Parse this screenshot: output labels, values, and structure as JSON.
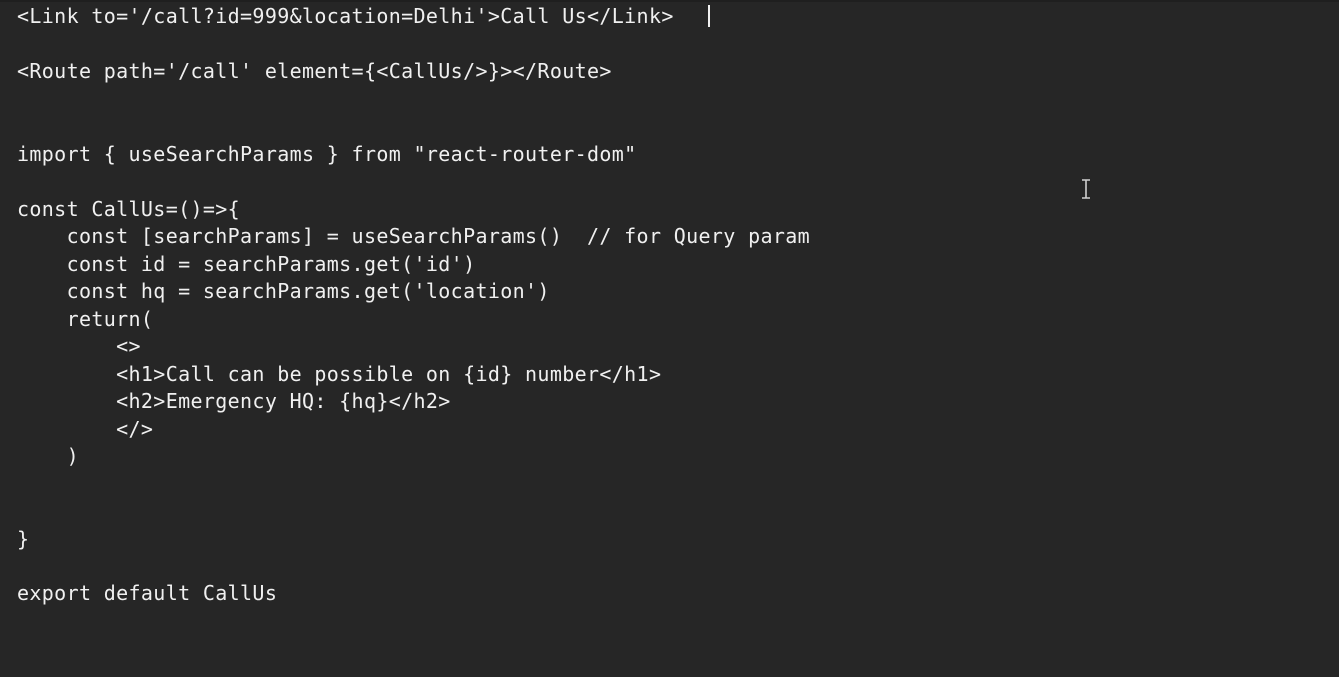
{
  "code": {
    "lines": [
      "<Link to='/call?id=999&location=Delhi'>Call Us</Link>",
      "<Route path='/call' element={<CallUs/>}></Route>",
      "import { useSearchParams } from \"react-router-dom\"",
      "const CallUs=()=>{",
      "    const [searchParams] = useSearchParams()  // for Query param",
      "    const id = searchParams.get('id')",
      "    const hq = searchParams.get('location')",
      "    return(",
      "        <>",
      "        <h1>Call can be possible on {id} number</h1>",
      "        <h2>Emergency HQ: {hq}</h2>",
      "        </>",
      "    )",
      "}",
      "export default CallUs"
    ]
  },
  "cursor": {
    "icon": "text-cursor-icon"
  },
  "colors": {
    "background": "#262626",
    "text": "#f0f0f0"
  }
}
